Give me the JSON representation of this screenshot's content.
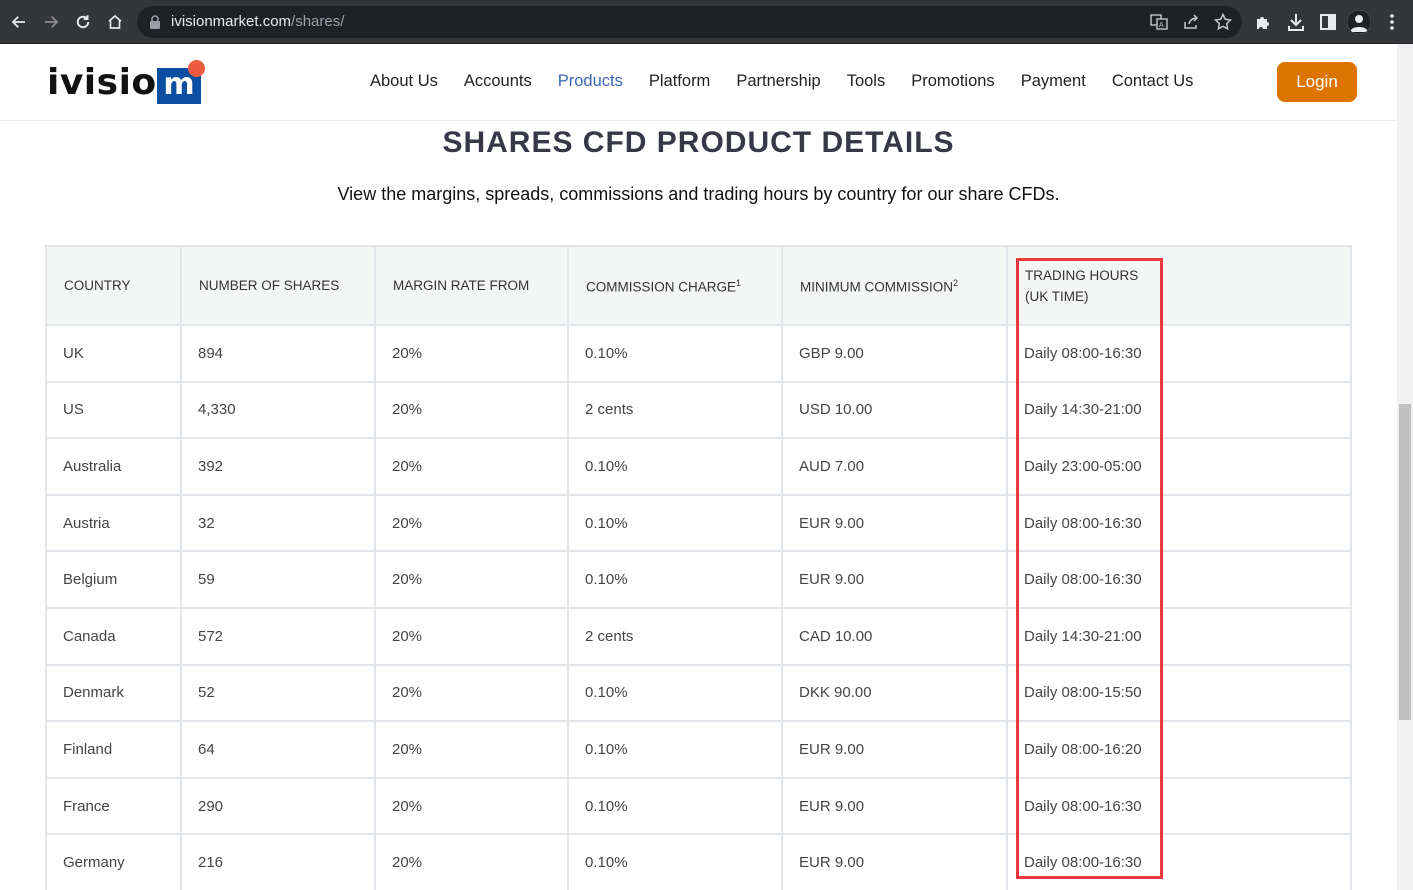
{
  "browser": {
    "url_domain": "ivisionmarket.com",
    "url_path": "/shares/",
    "nav_icons": [
      "back-icon",
      "forward-icon",
      "reload-icon",
      "home-icon"
    ],
    "omnibox_icons": [
      "translate-icon",
      "share-icon",
      "bookmark-star-icon"
    ],
    "toolbar_icons": [
      "extensions-icon",
      "download-icon",
      "side-panel-icon",
      "profile-icon",
      "menu-icon"
    ]
  },
  "site": {
    "logo_text": "ivision",
    "logo_mark": "m",
    "colors": {
      "brand_blue": "#0b4ea2",
      "logo_dot": "#ef5b3f",
      "login_orange": "#dd7400",
      "active_nav": "#3b67b3",
      "highlight_red": "#ee3a3c"
    },
    "nav": [
      {
        "label": "About Us",
        "active": false
      },
      {
        "label": "Accounts",
        "active": false
      },
      {
        "label": "Products",
        "active": true
      },
      {
        "label": "Platform",
        "active": false
      },
      {
        "label": "Partnership",
        "active": false
      },
      {
        "label": "Tools",
        "active": false
      },
      {
        "label": "Promotions",
        "active": false
      },
      {
        "label": "Payment",
        "active": false
      },
      {
        "label": "Contact Us",
        "active": false
      }
    ],
    "login_label": "Login"
  },
  "content": {
    "title": "SHARES CFD PRODUCT DETAILS",
    "subtitle": "View the margins, spreads, commissions and trading hours by country for our share CFDs."
  },
  "table": {
    "headers": [
      {
        "label": "COUNTRY",
        "sup": ""
      },
      {
        "label": "NUMBER OF SHARES",
        "sup": ""
      },
      {
        "label": "MARGIN RATE FROM",
        "sup": ""
      },
      {
        "label": "COMMISSION CHARGE",
        "sup": "1"
      },
      {
        "label": "MINIMUM COMMISSION",
        "sup": "2"
      },
      {
        "label": "TRADING HOURS",
        "label2": "(UK TIME)",
        "sup": ""
      }
    ],
    "rows": [
      [
        "UK",
        "894",
        "20%",
        "0.10%",
        "GBP 9.00",
        "Daily 08:00-16:30"
      ],
      [
        "US",
        "4,330",
        "20%",
        "2 cents",
        "USD 10.00",
        "Daily 14:30-21:00"
      ],
      [
        "Australia",
        "392",
        "20%",
        "0.10%",
        "AUD 7.00",
        "Daily 23:00-05:00"
      ],
      [
        "Austria",
        "32",
        "20%",
        "0.10%",
        "EUR 9.00",
        "Daily 08:00-16:30"
      ],
      [
        "Belgium",
        "59",
        "20%",
        "0.10%",
        "EUR 9.00",
        "Daily 08:00-16:30"
      ],
      [
        "Canada",
        "572",
        "20%",
        "2 cents",
        "CAD 10.00",
        "Daily 14:30-21:00"
      ],
      [
        "Denmark",
        "52",
        "20%",
        "0.10%",
        "DKK 90.00",
        "Daily 08:00-15:50"
      ],
      [
        "Finland",
        "64",
        "20%",
        "0.10%",
        "EUR 9.00",
        "Daily 08:00-16:20"
      ],
      [
        "France",
        "290",
        "20%",
        "0.10%",
        "EUR 9.00",
        "Daily 08:00-16:30"
      ],
      [
        "Germany",
        "216",
        "20%",
        "0.10%",
        "EUR 9.00",
        "Daily 08:00-16:30"
      ]
    ]
  }
}
